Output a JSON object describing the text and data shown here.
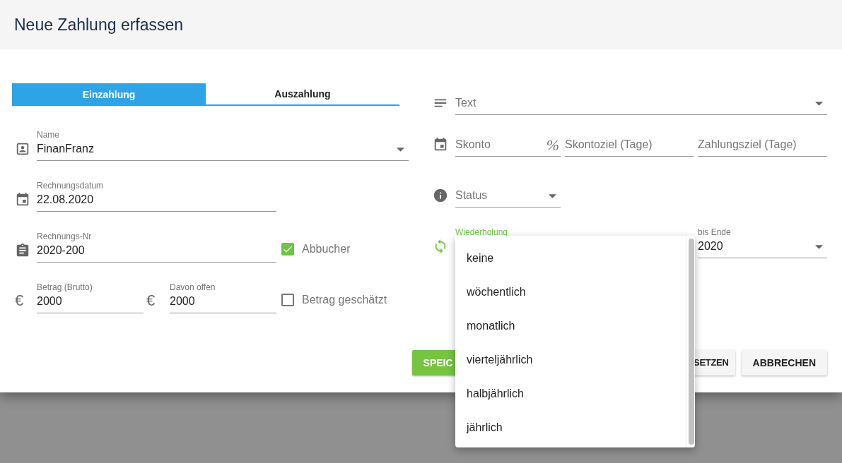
{
  "dialog": {
    "title": "Neue Zahlung erfassen"
  },
  "tabs": [
    {
      "label": "Einzahlung",
      "selected": true
    },
    {
      "label": "Auszahlung",
      "selected": false
    }
  ],
  "left_rows": [
    {
      "fields": [
        {
          "kind": "select",
          "label": "Name",
          "value": "FinanFranz",
          "focused": false
        }
      ]
    },
    {
      "fields": [
        {
          "kind": "text",
          "label": "Rechnungsdatum",
          "value": "22.08.2020",
          "focused": false
        }
      ]
    },
    {
      "fields": [
        {
          "kind": "text",
          "label": "Rechnungs-Nr",
          "value": "2020-200",
          "focused": false
        }
      ],
      "checkbox": {
        "label": "Abbucher",
        "checked": true
      }
    },
    {
      "fields": [
        {
          "kind": "text",
          "label": "Betrag (Brutto)",
          "value": "2000",
          "prefix": "€",
          "focused": false
        },
        {
          "kind": "text",
          "label": "Davon offen",
          "value": "2000",
          "prefix": "€",
          "focused": false
        }
      ],
      "checkbox": {
        "label": "Betrag geschätzt",
        "checked": false
      }
    }
  ],
  "right_rows": [
    {
      "fields": [
        {
          "kind": "select",
          "label": "Text",
          "focused": false
        }
      ]
    },
    {
      "fields": [
        {
          "kind": "text",
          "label": "Skonto",
          "suffix": "%",
          "focused": false
        },
        {
          "kind": "text",
          "label": "Skontoziel (Tage)",
          "focused": false
        },
        {
          "kind": "text",
          "label": "Zahlungsziel (Tage)",
          "focused": false
        }
      ]
    },
    {
      "fields": [
        {
          "kind": "select",
          "label": "Status",
          "focused": false
        }
      ]
    },
    {
      "fields": [
        {
          "kind": "select",
          "label": "Wiederholung",
          "focused": true
        },
        {
          "kind": "select",
          "label": "bis Ende",
          "value": "2020",
          "focused": false
        }
      ]
    }
  ],
  "dropdown": {
    "options": [
      "keine",
      "wöchentlich",
      "monatlich",
      "vierteljährlich",
      "halbjährlich",
      "jährlich"
    ]
  },
  "buttons": [
    {
      "label": "SPEIC",
      "kind": "primary"
    },
    {
      "label": "SETZEN",
      "kind": "secondary"
    },
    {
      "label": "ABBRECHEN",
      "kind": "secondary"
    }
  ]
}
